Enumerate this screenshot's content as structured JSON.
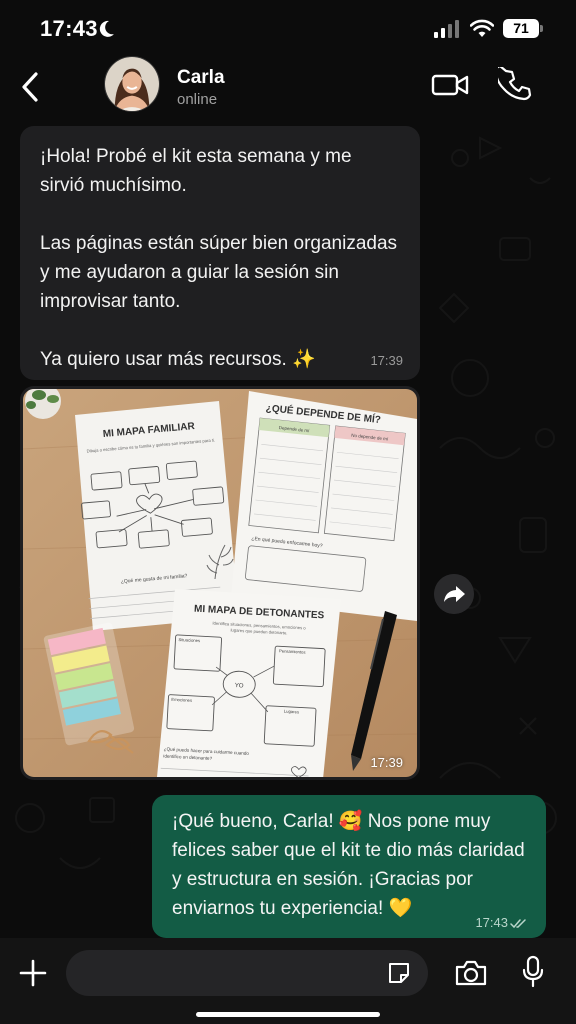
{
  "status_bar": {
    "time": "17:43",
    "battery": "71"
  },
  "contact": {
    "name": "Carla",
    "status": "online"
  },
  "messages": {
    "incoming_text": {
      "paragraph_1": "¡Hola! Probé el kit esta semana y me sirvió muchísimo.",
      "paragraph_2": "Las páginas están súper bien organizadas y me ayudaron a guiar la sesión sin improvisar tanto.",
      "paragraph_3": "Ya quiero usar más recursos. ✨",
      "time": "17:39"
    },
    "incoming_photo": {
      "time": "17:39",
      "worksheet_1": {
        "title": "MI MAPA FAMILIAR",
        "instructions": "Dibuja o escribe cómo es tu familia y quiénes son importantes para ti.",
        "question": "¿Qué me gusta de mi familia?"
      },
      "worksheet_2": {
        "title": "¿QUÉ DEPENDE DE MÍ?",
        "column_1": "Depende de mí",
        "column_2": "No depende de mí",
        "question": "¿En qué puedo enfocarme hoy?"
      },
      "worksheet_3": {
        "title": "MI MAPA DE DETONANTES",
        "instructions_1": "Identifica situaciones, pensamientos, emociones o",
        "instructions_2": "lugares que pueden detonarte.",
        "center": "YO",
        "box_1": "Situaciones",
        "box_2": "Pensamientos",
        "box_3": "Emociones",
        "box_4": "Lugares",
        "question_1": "¿Qué puedo hacer para cuidarme cuando",
        "question_2": "identifico un detonante?"
      }
    },
    "outgoing_text": {
      "text": "¡Qué bueno, Carla! 🥰 Nos pone muy felices saber que el kit te dio más claridad y estructura en sesión. ¡Gracias por enviarnos tu experiencia! 💛",
      "time": "17:43"
    }
  },
  "composer": {
    "placeholder": ""
  },
  "colors": {
    "background": "#0c0c0c",
    "incoming_bubble": "#1f1f21",
    "outgoing_bubble": "#135c45",
    "read_ticks": "#b9d6cb"
  },
  "icons": {
    "back": "chevron-left-icon",
    "video": "video-camera-icon",
    "call": "phone-icon",
    "forward": "forward-arrow-icon",
    "plus": "plus-icon",
    "sticker": "sticker-icon",
    "camera": "camera-icon",
    "mic": "microphone-icon"
  }
}
